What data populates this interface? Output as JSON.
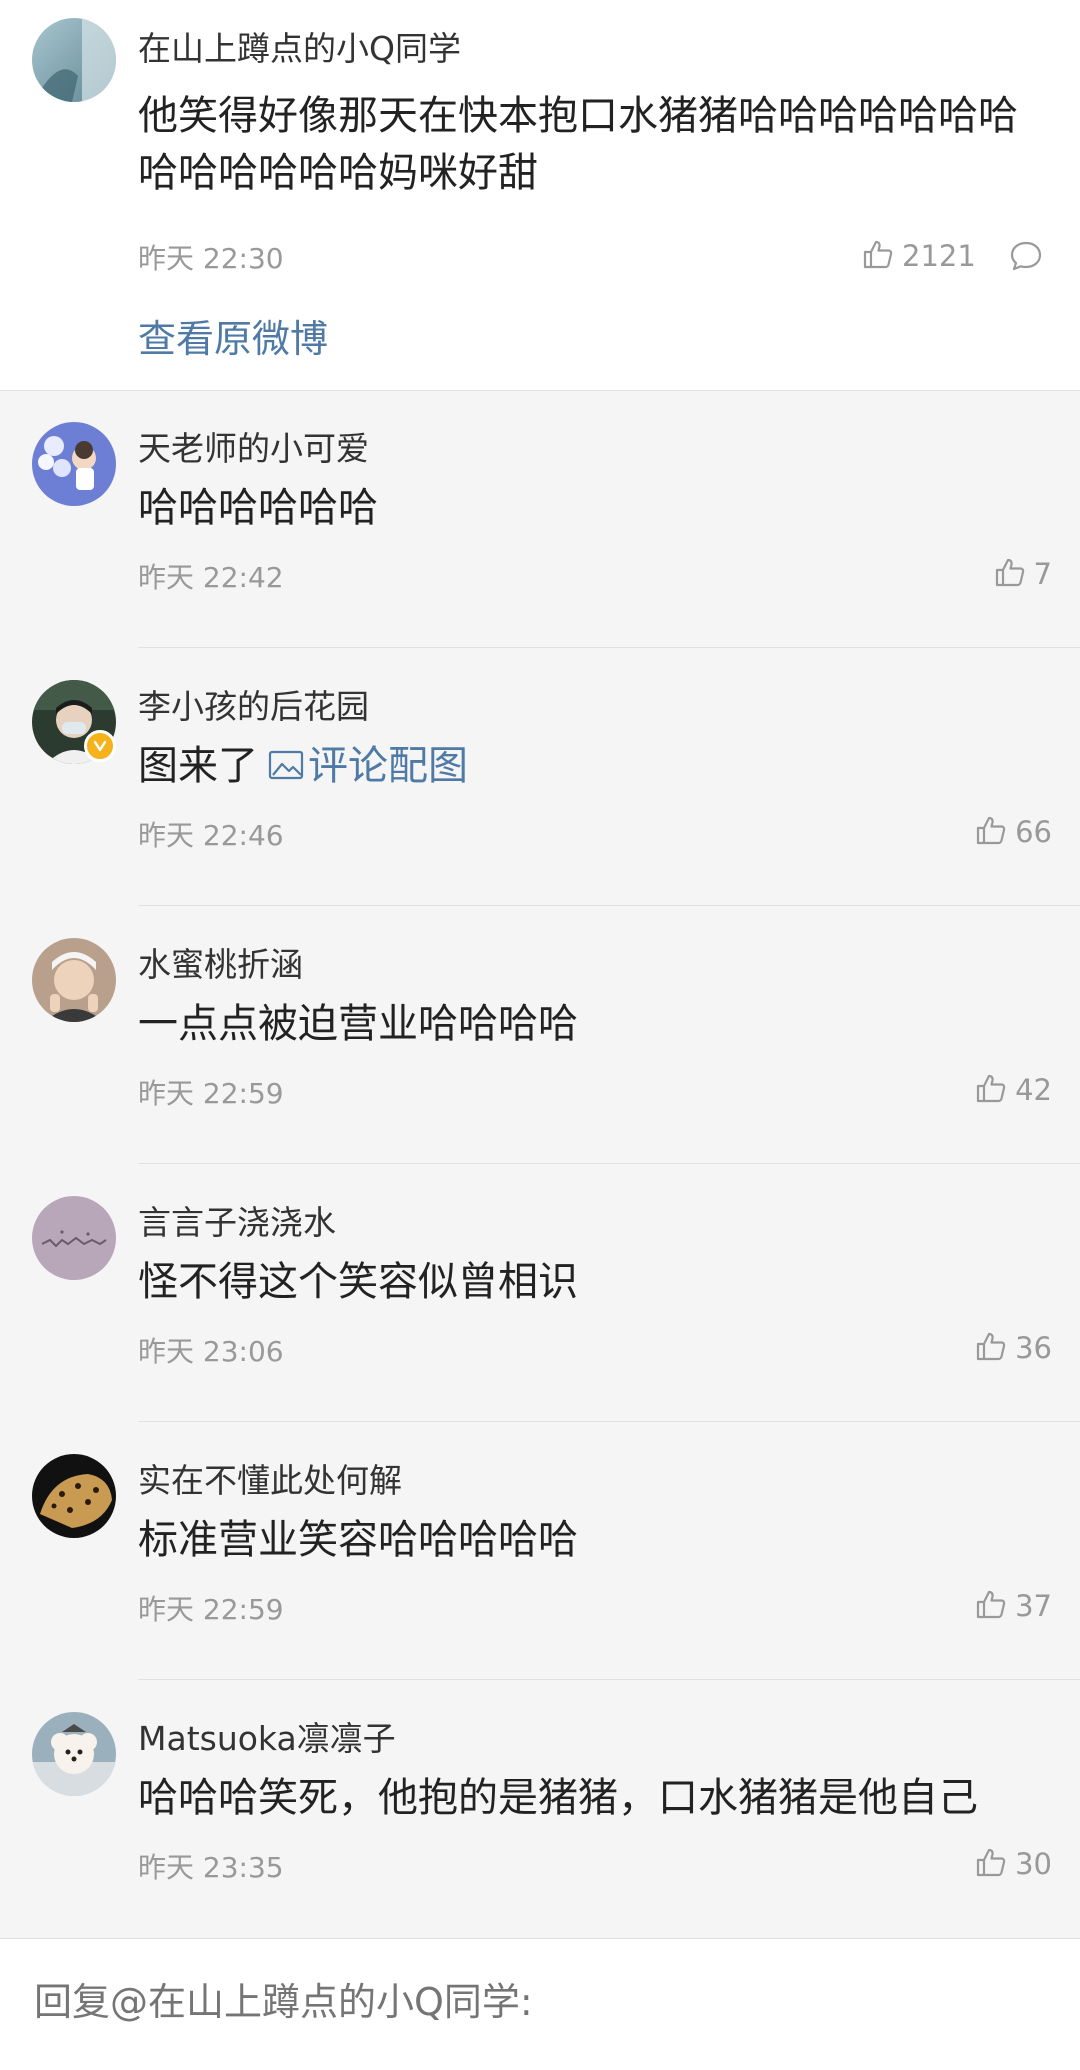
{
  "root_comment": {
    "author": "在山上蹲点的小Q同学",
    "text": "他笑得好像那天在快本抱口水猪猪哈哈哈哈哈哈哈哈哈哈哈哈哈妈咪好甜",
    "time": "昨天 22:30",
    "likes": "2121",
    "view_original": "查看原微博",
    "icons": [
      "avatar",
      "like-icon",
      "reply-icon"
    ]
  },
  "replies": [
    {
      "author": "天老师的小可爱",
      "text": "哈哈哈哈哈哈",
      "time": "昨天 22:42",
      "likes": "7"
    },
    {
      "author": "李小孩的后花园",
      "text": "图来了",
      "link_text": "评论配图",
      "time": "昨天 22:46",
      "likes": "66",
      "verified": true
    },
    {
      "author": "水蜜桃折涵",
      "text": "一点点被迫营业哈哈哈哈",
      "time": "昨天 22:59",
      "likes": "42"
    },
    {
      "author": "言言子浇浇水",
      "text": "怪不得这个笑容似曾相识",
      "time": "昨天 23:06",
      "likes": "36"
    },
    {
      "author": "实在不懂此处何解",
      "text": "标准营业笑容哈哈哈哈哈",
      "time": "昨天 22:59",
      "likes": "37"
    },
    {
      "author": "Matsuoka凛凛子",
      "text": "哈哈哈笑死，他抱的是猪猪，口水猪猪是他自己",
      "time": "昨天 23:35",
      "likes": "30"
    }
  ],
  "reply_bar": {
    "placeholder": "回复@在山上蹲点的小Q同学:"
  },
  "colors": {
    "link": "#4e7aa5",
    "muted": "#999999",
    "text": "#222222",
    "background": "#f5f5f5",
    "verified": "#f5b21b"
  }
}
